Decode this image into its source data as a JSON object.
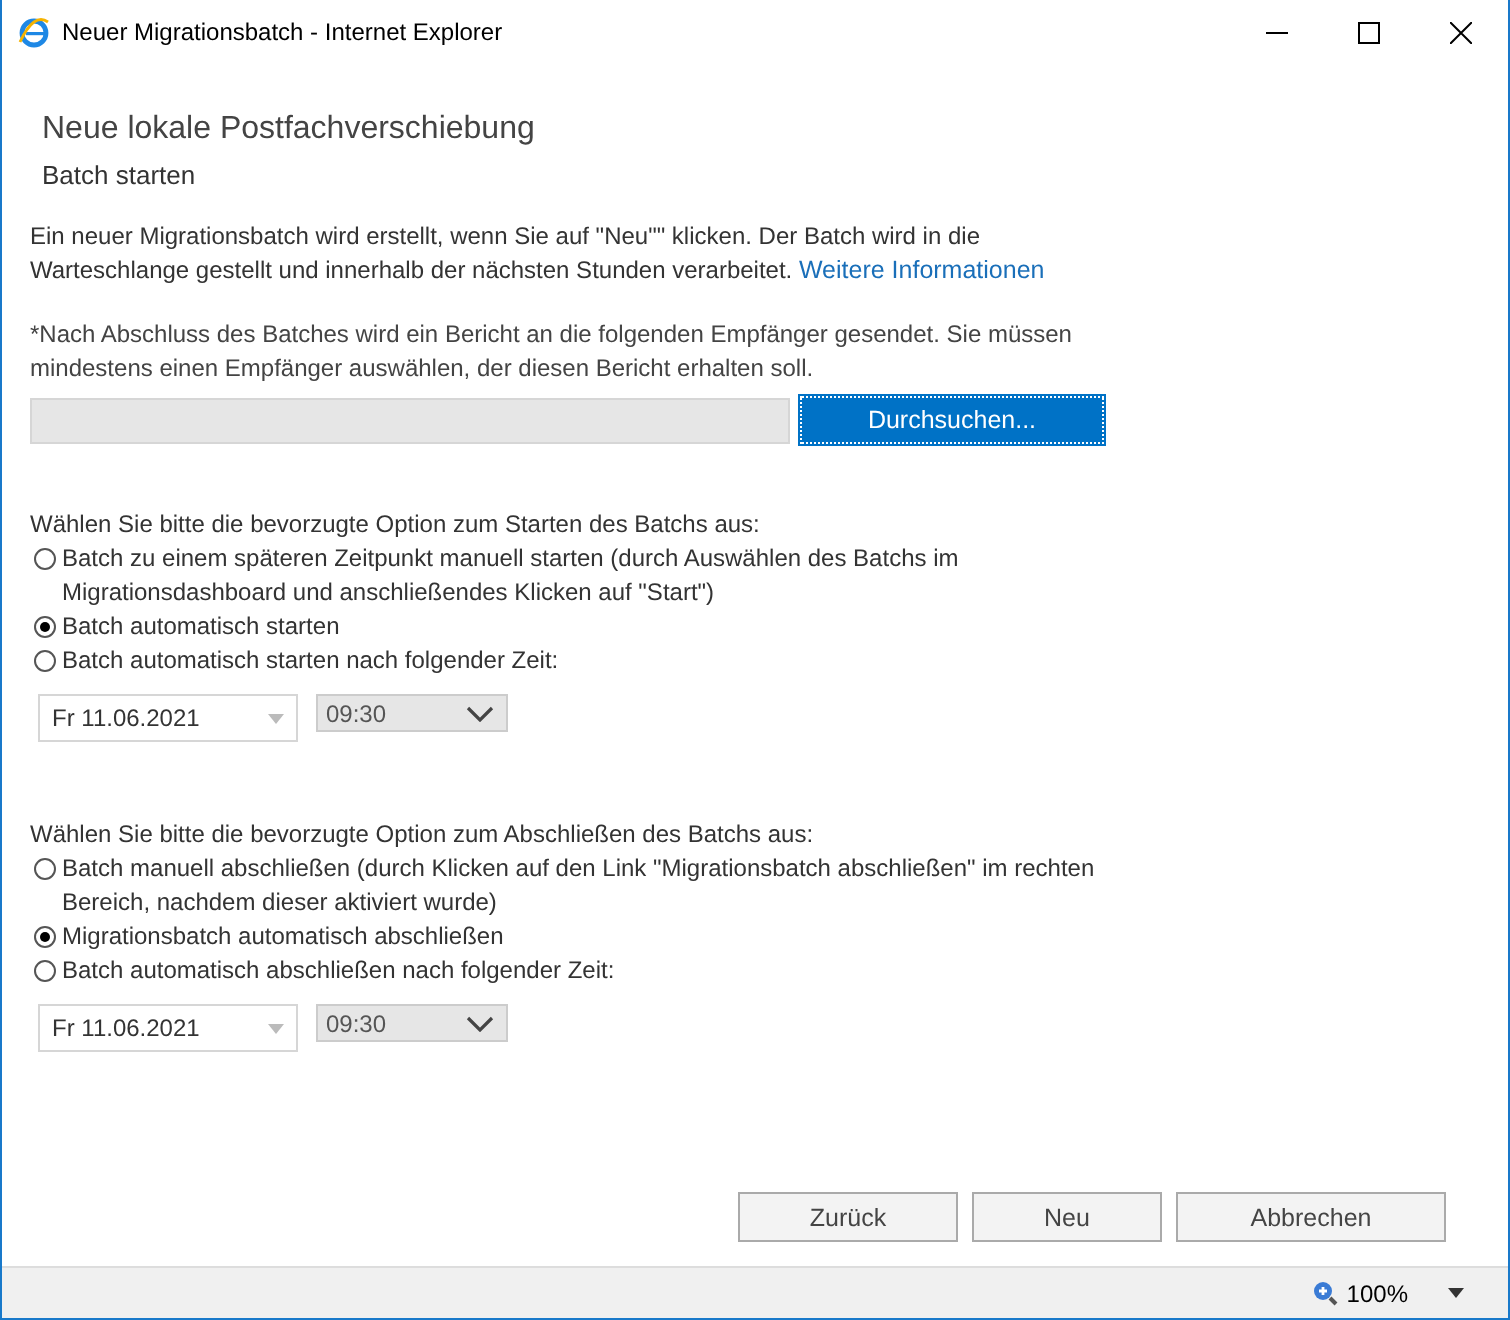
{
  "window": {
    "title": "Neuer Migrationsbatch - Internet Explorer"
  },
  "heading": "Neue lokale Postfachverschiebung",
  "subheading": "Batch starten",
  "intro": {
    "text": "Ein neuer Migrationsbatch wird erstellt, wenn Sie auf \"Neu\"\" klicken. Der Batch wird in die Warteschlange gestellt und innerhalb der nächsten Stunden verarbeitet.",
    "link": "Weitere Informationen"
  },
  "note": "*Nach Abschluss des Batches wird ein Bericht an die folgenden Empfänger gesendet. Sie müssen mindestens einen Empfänger auswählen, der diesen Bericht erhalten soll.",
  "browse_button": "Durchsuchen...",
  "sections": [
    {
      "prompt": "Wählen Sie bitte die bevorzugte Option zum Starten des Batchs aus:",
      "options": [
        {
          "label": "Batch zu einem späteren Zeitpunkt manuell starten (durch Auswählen des Batchs im Migrationsdashboard und anschließendes Klicken auf \"Start\")",
          "selected": false
        },
        {
          "label": "Batch automatisch starten",
          "selected": true
        },
        {
          "label": "Batch automatisch starten nach folgender Zeit:",
          "selected": false
        }
      ],
      "date": "Fr 11.06.2021",
      "time": "09:30"
    },
    {
      "prompt": "Wählen Sie bitte die bevorzugte Option zum Abschließen des Batchs aus:",
      "options": [
        {
          "label": "Batch manuell abschließen (durch Klicken auf den Link \"Migrationsbatch abschließen\" im rechten Bereich, nachdem dieser aktiviert wurde)",
          "selected": false
        },
        {
          "label": "Migrationsbatch automatisch abschließen",
          "selected": true
        },
        {
          "label": "Batch automatisch abschließen nach folgender Zeit:",
          "selected": false
        }
      ],
      "date": "Fr 11.06.2021",
      "time": "09:30"
    }
  ],
  "buttons": [
    "Zurück",
    "Neu",
    "Abbrechen"
  ],
  "status_bar": {
    "zoom": "100%"
  }
}
